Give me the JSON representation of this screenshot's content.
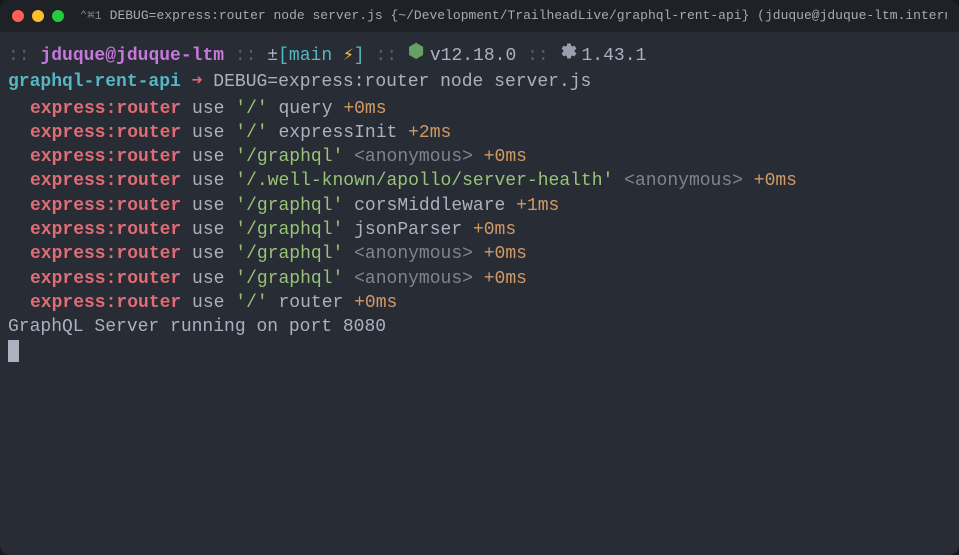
{
  "titlebar": {
    "shortcut": "⌃⌘1",
    "text": "DEBUG=express:router node server.js {~/Development/TrailheadLive/graphql-rent-api} (jduque@jduque-ltm.internal.salesforce.com)"
  },
  "prompt": {
    "sep1": "::",
    "userHost": "jduque@jduque-ltm",
    "sep2": "::",
    "plusminus": "±",
    "branchOpen": "[",
    "branch": "main",
    "thunder": "⚡",
    "branchClose": "]",
    "sep3": "::",
    "nodeVersion": "v12.18.0",
    "sep4": "::",
    "rubyVersion": "1.43.1",
    "dirName": "graphql-rent-api",
    "arrow": "➜",
    "command": "DEBUG=express:router node server.js"
  },
  "logs": [
    {
      "ns": "express:router",
      "verb": "use",
      "path": "'/'",
      "handler": "query",
      "timing": "+0ms",
      "anon": false
    },
    {
      "ns": "express:router",
      "verb": "use",
      "path": "'/'",
      "handler": "expressInit",
      "timing": "+2ms",
      "anon": false
    },
    {
      "ns": "express:router",
      "verb": "use",
      "path": "'/graphql'",
      "handler": "<anonymous>",
      "timing": "+0ms",
      "anon": true
    },
    {
      "ns": "express:router",
      "verb": "use",
      "path": "'/.well-known/apollo/server-health'",
      "handler": "<anonymous>",
      "timing": "+0ms",
      "anon": true
    },
    {
      "ns": "express:router",
      "verb": "use",
      "path": "'/graphql'",
      "handler": "corsMiddleware",
      "timing": "+1ms",
      "anon": false
    },
    {
      "ns": "express:router",
      "verb": "use",
      "path": "'/graphql'",
      "handler": "jsonParser",
      "timing": "+0ms",
      "anon": false
    },
    {
      "ns": "express:router",
      "verb": "use",
      "path": "'/graphql'",
      "handler": "<anonymous>",
      "timing": "+0ms",
      "anon": true
    },
    {
      "ns": "express:router",
      "verb": "use",
      "path": "'/graphql'",
      "handler": "<anonymous>",
      "timing": "+0ms",
      "anon": true
    },
    {
      "ns": "express:router",
      "verb": "use",
      "path": "'/'",
      "handler": "router",
      "timing": "+0ms",
      "anon": false
    }
  ],
  "status": "GraphQL Server running on port 8080"
}
